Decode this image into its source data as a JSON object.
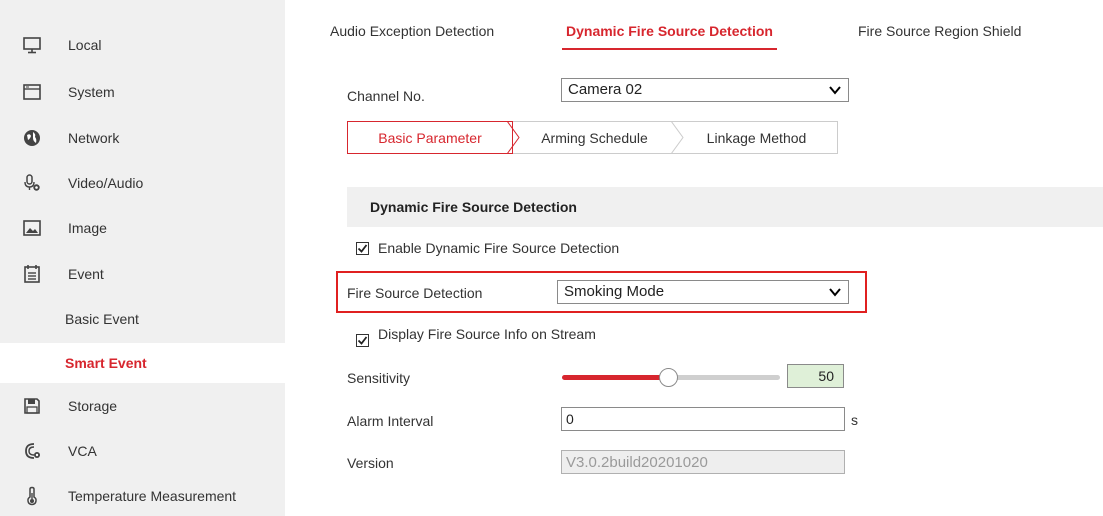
{
  "sidebar": {
    "items": [
      {
        "label": "Local",
        "icon": "monitor-icon"
      },
      {
        "label": "System",
        "icon": "window-icon"
      },
      {
        "label": "Network",
        "icon": "globe-icon"
      },
      {
        "label": "Video/Audio",
        "icon": "microphone-icon"
      },
      {
        "label": "Image",
        "icon": "image-icon"
      },
      {
        "label": "Event",
        "icon": "calendar-icon"
      },
      {
        "label": "Basic Event"
      },
      {
        "label": "Smart Event"
      },
      {
        "label": "Storage",
        "icon": "floppy-disk-icon"
      },
      {
        "label": "VCA",
        "icon": "vca-icon"
      },
      {
        "label": "Temperature Measurement",
        "icon": "thermometer-icon"
      }
    ],
    "active_index": 7
  },
  "tabs": [
    {
      "label": "Audio Exception Detection"
    },
    {
      "label": "Dynamic Fire Source Detection"
    },
    {
      "label": "Fire Source Region Shield"
    }
  ],
  "channel": {
    "label": "Channel No.",
    "value": "Camera 02"
  },
  "subtabs": [
    {
      "label": "Basic Parameter"
    },
    {
      "label": "Arming Schedule"
    },
    {
      "label": "Linkage Method"
    }
  ],
  "section": {
    "title": "Dynamic Fire Source Detection"
  },
  "enable_detection": {
    "label": "Enable Dynamic Fire Source Detection",
    "checked": true
  },
  "fire_source_detection": {
    "label": "Fire Source Detection",
    "value": "Smoking Mode"
  },
  "display_info": {
    "label": "Display Fire Source Info on Stream",
    "checked": true
  },
  "sensitivity": {
    "label": "Sensitivity",
    "value": "50",
    "fraction": 0.5
  },
  "alarm_interval": {
    "label": "Alarm Interval",
    "value": "0",
    "unit": "s"
  },
  "version": {
    "label": "Version",
    "value": "V3.0.2build20201020"
  },
  "colors": {
    "accent": "#d7262e",
    "highlight": "#e02020",
    "sidebar_bg": "#f0f0f0"
  }
}
